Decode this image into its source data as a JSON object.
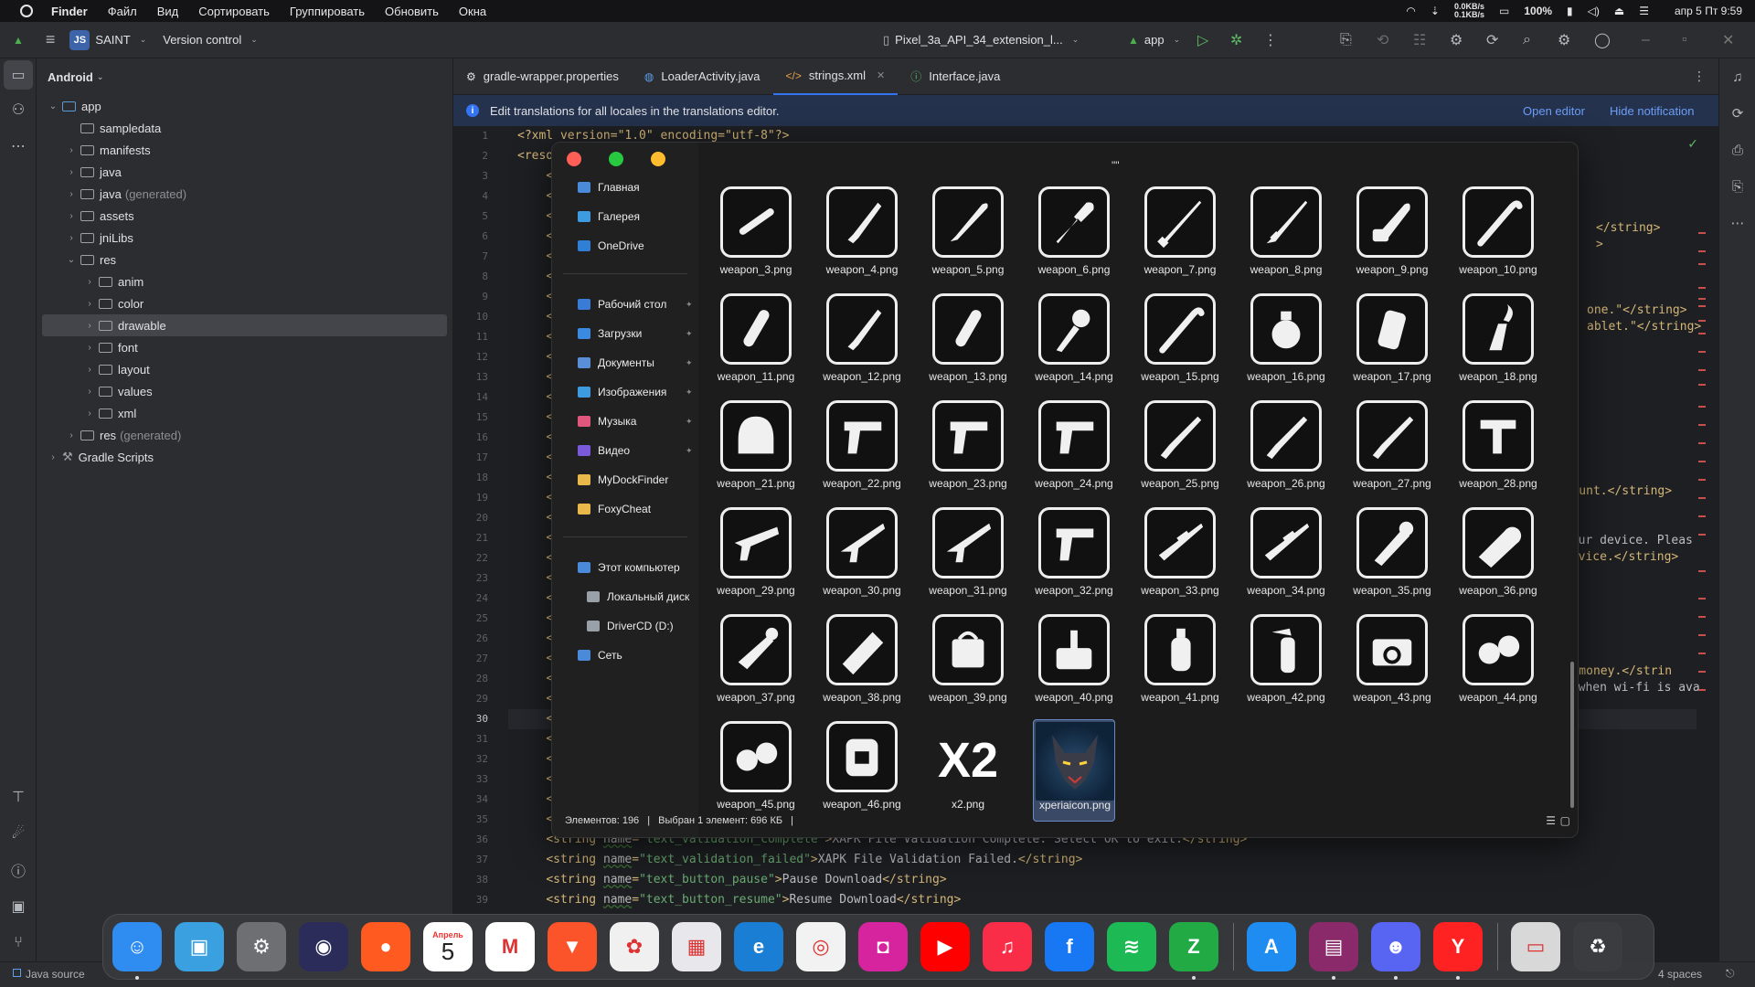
{
  "menubar": {
    "app": "Finder",
    "items": [
      "Файл",
      "Вид",
      "Сортировать",
      "Группировать",
      "Обновить",
      "Окна"
    ],
    "net_up": "0.0KB/s",
    "net_down": "0.1KB/s",
    "battery": "100%",
    "datetime": "апр 5 Пт 9:59"
  },
  "ide_toolbar": {
    "project_badge": "JS",
    "project_name": "SAINT",
    "vcs": "Version control",
    "device": "Pixel_3a_API_34_extension_l...",
    "run_config": "app"
  },
  "project_panel": {
    "view": "Android",
    "tree": [
      {
        "label": "app",
        "extra": "",
        "depth": 0,
        "arrow": "v",
        "type": "module"
      },
      {
        "label": "sampledata",
        "extra": "",
        "depth": 1,
        "arrow": "",
        "type": "folder"
      },
      {
        "label": "manifests",
        "extra": "",
        "depth": 1,
        "arrow": ">",
        "type": "folder"
      },
      {
        "label": "java",
        "extra": "",
        "depth": 1,
        "arrow": ">",
        "type": "folder"
      },
      {
        "label": "java",
        "extra": "(generated)",
        "depth": 1,
        "arrow": ">",
        "type": "folder"
      },
      {
        "label": "assets",
        "extra": "",
        "depth": 1,
        "arrow": ">",
        "type": "folder"
      },
      {
        "label": "jniLibs",
        "extra": "",
        "depth": 1,
        "arrow": ">",
        "type": "folder"
      },
      {
        "label": "res",
        "extra": "",
        "depth": 1,
        "arrow": "v",
        "type": "folder"
      },
      {
        "label": "anim",
        "extra": "",
        "depth": 2,
        "arrow": ">",
        "type": "folder"
      },
      {
        "label": "color",
        "extra": "",
        "depth": 2,
        "arrow": ">",
        "type": "folder"
      },
      {
        "label": "drawable",
        "extra": "",
        "depth": 2,
        "arrow": ">",
        "type": "folder",
        "selected": true
      },
      {
        "label": "font",
        "extra": "",
        "depth": 2,
        "arrow": ">",
        "type": "folder"
      },
      {
        "label": "layout",
        "extra": "",
        "depth": 2,
        "arrow": ">",
        "type": "folder"
      },
      {
        "label": "values",
        "extra": "",
        "depth": 2,
        "arrow": ">",
        "type": "folder"
      },
      {
        "label": "xml",
        "extra": "",
        "depth": 2,
        "arrow": ">",
        "type": "folder"
      },
      {
        "label": "res",
        "extra": "(generated)",
        "depth": 1,
        "arrow": ">",
        "type": "folder"
      },
      {
        "label": "Gradle Scripts",
        "extra": "",
        "depth": 0,
        "arrow": ">",
        "type": "gradle"
      }
    ]
  },
  "editor": {
    "tabs": [
      {
        "label": "gradle-wrapper.properties",
        "icon": "gear-icon"
      },
      {
        "label": "LoaderActivity.java",
        "icon": "class-icon"
      },
      {
        "label": "strings.xml",
        "icon": "xml-icon",
        "active": true
      },
      {
        "label": "Interface.java",
        "icon": "interface-icon"
      }
    ],
    "notification": "Edit translations for all locales in the translations editor.",
    "open_editor": "Open editor",
    "hide_notification": "Hide notification",
    "current_line": 30,
    "line_count": 39,
    "line1": "<?xml version=\"1.0\" encoding=\"utf-8\"?>",
    "line2_prefix": "<resou",
    "partial_prefix": "<s",
    "code_lines": [
      {
        "num": 36,
        "name": "text_validation_complete",
        "text": "XAPK File Validation Complete. Select OK to exit."
      },
      {
        "num": 37,
        "name": "text_validation_failed",
        "text": "XAPK File Validation Failed."
      },
      {
        "num": 38,
        "name": "text_button_pause",
        "text": "Pause Download"
      },
      {
        "num": 39,
        "name": "text_button_resume",
        "text": "Resume Download"
      }
    ],
    "right_fragments": [
      "</string>",
      ">",
      "one.\"</string>",
      "ablet.\"</string>",
      "account.</string>",
      "your device. Pleas",
      "device.</string>",
      "you money.</strin",
      "e when wi-fi is ava"
    ]
  },
  "finder": {
    "title_glyph": "\"\"",
    "sidebar": [
      {
        "label": "Главная",
        "icon": "home-icon",
        "color": "#4a8ad8"
      },
      {
        "label": "Галерея",
        "icon": "gallery-icon",
        "color": "#3f9be0"
      },
      {
        "label": "OneDrive",
        "icon": "onedrive-icon",
        "color": "#2f7fd6"
      },
      {
        "label": "Рабочий стол",
        "icon": "desktop-icon",
        "color": "#3a7bd5",
        "pinned": true
      },
      {
        "label": "Загрузки",
        "icon": "download-icon",
        "color": "#3a8be0",
        "pinned": true
      },
      {
        "label": "Документы",
        "icon": "documents-icon",
        "color": "#5a8fd8",
        "pinned": true
      },
      {
        "label": "Изображения",
        "icon": "images-icon",
        "color": "#3f9be0",
        "pinned": true
      },
      {
        "label": "Музыка",
        "icon": "music-icon",
        "color": "#e0567d",
        "pinned": true
      },
      {
        "label": "Видео",
        "icon": "video-icon",
        "color": "#7a5ad8",
        "pinned": true
      },
      {
        "label": "MyDockFinder",
        "icon": "folder-icon",
        "color": "#e8b84a"
      },
      {
        "label": "FoxyCheat",
        "icon": "folder-icon",
        "color": "#e8b84a"
      },
      {
        "label": "Этот компьютер",
        "icon": "computer-icon",
        "color": "#4a8ad8"
      },
      {
        "label": "Локальный диск",
        "icon": "disk-icon",
        "color": "#9aa0a8"
      },
      {
        "label": "DriverCD (D:)",
        "icon": "disk-icon",
        "color": "#9aa0a8"
      },
      {
        "label": "Сеть",
        "icon": "network-icon",
        "color": "#4a8ad8"
      }
    ],
    "files": [
      {
        "name": "weapon_3.png",
        "shape": "baton"
      },
      {
        "name": "weapon_4.png",
        "shape": "knife"
      },
      {
        "name": "weapon_5.png",
        "shape": "bat"
      },
      {
        "name": "weapon_6.png",
        "shape": "shovel"
      },
      {
        "name": "weapon_7.png",
        "shape": "cue"
      },
      {
        "name": "weapon_8.png",
        "shape": "katana"
      },
      {
        "name": "weapon_9.png",
        "shape": "chainsaw"
      },
      {
        "name": "weapon_10.png",
        "shape": "cane"
      },
      {
        "name": "weapon_11.png",
        "shape": "dildo"
      },
      {
        "name": "weapon_12.png",
        "shape": "knife"
      },
      {
        "name": "weapon_13.png",
        "shape": "dildo"
      },
      {
        "name": "weapon_14.png",
        "shape": "flowers"
      },
      {
        "name": "weapon_15.png",
        "shape": "cane"
      },
      {
        "name": "weapon_16.png",
        "shape": "grenade"
      },
      {
        "name": "weapon_17.png",
        "shape": "canister"
      },
      {
        "name": "weapon_18.png",
        "shape": "molotov"
      },
      {
        "name": "weapon_21.png",
        "shape": "helmet"
      },
      {
        "name": "weapon_22.png",
        "shape": "pistol"
      },
      {
        "name": "weapon_23.png",
        "shape": "pistol"
      },
      {
        "name": "weapon_24.png",
        "shape": "pistol"
      },
      {
        "name": "weapon_25.png",
        "shape": "shotgun"
      },
      {
        "name": "weapon_26.png",
        "shape": "shotgun"
      },
      {
        "name": "weapon_27.png",
        "shape": "shotgun"
      },
      {
        "name": "weapon_28.png",
        "shape": "uzi"
      },
      {
        "name": "weapon_29.png",
        "shape": "smg"
      },
      {
        "name": "weapon_30.png",
        "shape": "rifle"
      },
      {
        "name": "weapon_31.png",
        "shape": "rifle"
      },
      {
        "name": "weapon_32.png",
        "shape": "pistol"
      },
      {
        "name": "weapon_33.png",
        "shape": "sniper"
      },
      {
        "name": "weapon_34.png",
        "shape": "sniper"
      },
      {
        "name": "weapon_35.png",
        "shape": "rocket"
      },
      {
        "name": "weapon_36.png",
        "shape": "launcher"
      },
      {
        "name": "weapon_37.png",
        "shape": "flamer"
      },
      {
        "name": "weapon_38.png",
        "shape": "minigun"
      },
      {
        "name": "weapon_39.png",
        "shape": "satchel"
      },
      {
        "name": "weapon_40.png",
        "shape": "detonator"
      },
      {
        "name": "weapon_41.png",
        "shape": "spray"
      },
      {
        "name": "weapon_42.png",
        "shape": "extinguisher"
      },
      {
        "name": "weapon_43.png",
        "shape": "camera"
      },
      {
        "name": "weapon_44.png",
        "shape": "goggles"
      },
      {
        "name": "weapon_45.png",
        "shape": "goggles"
      },
      {
        "name": "weapon_46.png",
        "shape": "parachute"
      },
      {
        "name": "x2.png",
        "shape": "x2",
        "label": "X2"
      },
      {
        "name": "xperiaicon.png",
        "shape": "wolf",
        "selected": true
      }
    ],
    "status_count": "Элементов: 196",
    "status_selected": "Выбран 1 элемент: 696 КБ"
  },
  "statusbar": {
    "left": "Java source",
    "right": "4 spaces"
  },
  "dock": {
    "calendar_month": "Апрель",
    "calendar_day": "5",
    "apps": [
      {
        "name": "finder",
        "color": "#2f8cf0",
        "glyph": "☺",
        "running": true
      },
      {
        "name": "preview",
        "color": "#3aa0e0",
        "glyph": "▣"
      },
      {
        "name": "system-settings",
        "color": "#6d6f73",
        "glyph": "⚙"
      },
      {
        "name": "siri",
        "color": "#2c2c5a",
        "glyph": "◉"
      },
      {
        "name": "reddit",
        "color": "#ff5a1f",
        "glyph": "●"
      },
      {
        "name": "calendar",
        "color": "#ffffff",
        "glyph": ""
      },
      {
        "name": "gmail",
        "color": "#ffffff",
        "glyph": "M"
      },
      {
        "name": "brave",
        "color": "#fb542b",
        "glyph": "▼"
      },
      {
        "name": "photos",
        "color": "#f0f0f0",
        "glyph": "✿"
      },
      {
        "name": "launchpad",
        "color": "#e8e8ec",
        "glyph": "▦"
      },
      {
        "name": "edge",
        "color": "#1a7fd4",
        "glyph": "e"
      },
      {
        "name": "chrome",
        "color": "#f2f2f2",
        "glyph": "◎"
      },
      {
        "name": "instagram",
        "color": "#d6249f",
        "glyph": "◘"
      },
      {
        "name": "youtube",
        "color": "#ff0000",
        "glyph": "▶"
      },
      {
        "name": "music",
        "color": "#fa2d48",
        "glyph": "♫"
      },
      {
        "name": "facebook",
        "color": "#1877f2",
        "glyph": "f"
      },
      {
        "name": "spotify",
        "color": "#1db954",
        "glyph": "≋"
      },
      {
        "name": "xbox-tool",
        "color": "#22aa44",
        "glyph": "Z",
        "running": true
      },
      {
        "name": "app-store",
        "color": "#1e8cf0",
        "glyph": "A",
        "sep_before": true
      },
      {
        "name": "winrar",
        "color": "#8a2a6a",
        "glyph": "▤",
        "running": true
      },
      {
        "name": "discord",
        "color": "#5865f2",
        "glyph": "☻",
        "running": true
      },
      {
        "name": "yandex",
        "color": "#ff2222",
        "glyph": "Y",
        "running": true
      },
      {
        "name": "trash-preview",
        "color": "#d8d8d8",
        "glyph": "▭",
        "sep_before": true
      },
      {
        "name": "recycle-bin",
        "color": "#3a3c40",
        "glyph": "♻"
      }
    ]
  }
}
